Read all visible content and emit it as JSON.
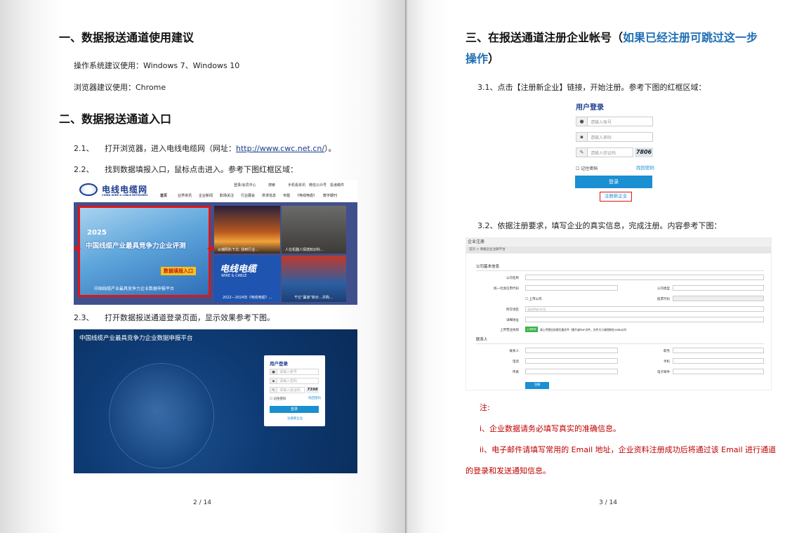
{
  "left_page": {
    "h1": "一、数据报送通道使用建议",
    "os_line": "操作系统建议使用：Windows 7、Windows 10",
    "browser_line": "浏览器建议使用：Chrome",
    "h2": "二、数据报送通道入口",
    "step_2_1_num": "2.1、",
    "step_2_1_pre": "打开浏览器，进入电线电缆网（网址：",
    "step_2_1_url": "http://www.cwc.net.cn/",
    "step_2_1_post": "）。",
    "step_2_2_num": "2.2、",
    "step_2_2_text": "找到数据填报入口，鼠标点击进入。参考下图红框区域：",
    "step_2_3_num": "2.3、",
    "step_2_3_text": "打开数据报送通道登录页面，显示效果参考下图。",
    "page_number": "2 / 14"
  },
  "website": {
    "logo_cn": "电线电缆网",
    "logo_en": "CHINA WIRE & CABLE NETWORKS",
    "top_links": [
      "登录/会员中心",
      "搜索",
      "手机看资讯",
      "微信公众号",
      "投递稿件"
    ],
    "nav": [
      "首页",
      "业界资讯",
      "企业新闻",
      "职场关注",
      "行业展会",
      "供求信息",
      "专题",
      "《电线电缆》",
      "数字期刊"
    ],
    "banner_year": "2025",
    "banner_title": "中国线缆产业最具竞争力企业评测",
    "banner_button": "数据填报入口",
    "banner_caption": "中国线缆产业最具竞争力企业数据申报平台",
    "thumb1_caption": "从瑞阳扒下文: 找到行业...",
    "thumb2_caption": "人在机器人情境知识科...",
    "thumb3_title": "电线电缆",
    "thumb3_sub": "WIRE & CABLE",
    "thumb3_caption": "2022—2024年《电线电缆》...",
    "thumb4_caption": "千亿“赢家”新价...并购…"
  },
  "portal": {
    "title": "中国线缆产业最具竞争力企业数据申报平台",
    "login_title": "用户登录",
    "account_ph": "请输入账号",
    "password_ph": "请输入密码",
    "captcha_ph": "请输入验证码",
    "captcha_code": "7398",
    "remember": "记住密码",
    "forgot": "找回密码",
    "login_btn": "登录",
    "register": "注册新企业"
  },
  "right_page": {
    "h3_pre": "三、在报送通道注册企业帐号（",
    "h3_blue": "如果已经注册可跳过这一步",
    "h3_blue2": "操作",
    "h3_post": "）",
    "step_3_1": "3.1、点击【注册新企业】链接，开始注册。参考下图的红框区域：",
    "step_3_2": "3.2、依据注册要求，填写企业的真实信息，完成注册。内容参考下图：",
    "note_title": "注:",
    "note_1": "i、企业数据请务必填写真实的准确信息。",
    "note_2a": "ii、电子邮件请填写常用的 Email 地址，企业资料注册成功后将通过该 Email 进行通道",
    "note_2b": "的登录和发送通知信息。",
    "page_number": "3 / 14"
  },
  "login_box": {
    "title": "用户登录",
    "account_ph": "请输入账号",
    "password_ph": "请输入密码",
    "captcha_ph": "请输入验证码",
    "captcha_code": "7806",
    "remember": "记住密码",
    "forgot": "找回密码",
    "login_btn": "登录",
    "register": "注册新企业"
  },
  "reg_form": {
    "header": "企业注册",
    "breadcrumb": "首页 > 填报企业注册平台",
    "section1": "公司基本信息",
    "company_name": "公司名称",
    "credit_code": "统一社会信用代码",
    "company_type": "公司类型",
    "listed": "上市公司",
    "stock_code": "股票代码",
    "region": "所在地区",
    "region_ph": "请选择省/市/区",
    "address": "详细地址",
    "upload_label": "上传营业执照",
    "upload_btn": "上传附件",
    "upload_hint": "请上传营业执照扫描文件（图片或PDF文件，文件大小请控制在2MB以内）",
    "section2": "联系人",
    "contact": "联系人",
    "dept": "职务",
    "phone": "电话",
    "mobile": "手机",
    "fax": "传真",
    "email": "电子邮件",
    "submit": "注册"
  },
  "colors": {
    "blue_heading": "#1f6fb5",
    "red_note": "#c00000",
    "button_blue": "#1a8fd1",
    "portal_bg": "#0e3a73"
  }
}
